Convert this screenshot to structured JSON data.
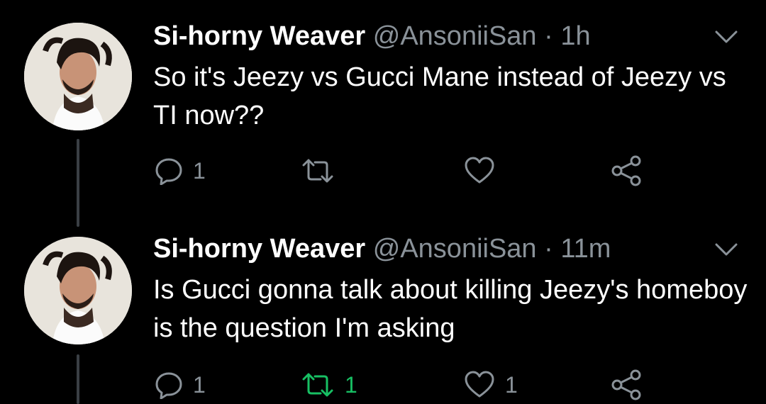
{
  "colors": {
    "background": "#000000",
    "secondary_text": "#8a9299",
    "retweeted": "#17bf63",
    "thread_line": "#3a3f44"
  },
  "tweets": [
    {
      "name": "Si-horny Weaver",
      "handle": "@AnsoniiSan",
      "separator": "·",
      "time": "1h",
      "text": "So it's Jeezy vs Gucci Mane instead of Jeezy vs TI now??",
      "reply_count": "1",
      "retweet_count": "",
      "like_count": "",
      "retweeted": false,
      "icons": [
        "avatar",
        "chevron-down-icon",
        "reply-icon",
        "retweet-icon",
        "like-icon",
        "share-icon"
      ]
    },
    {
      "name": "Si-horny Weaver",
      "handle": "@AnsoniiSan",
      "separator": "·",
      "time": "11m",
      "text": "Is Gucci gonna talk about killing Jeezy's homeboy is the question I'm asking",
      "reply_count": "1",
      "retweet_count": "1",
      "like_count": "1",
      "retweeted": true,
      "icons": [
        "avatar",
        "chevron-down-icon",
        "reply-icon",
        "retweet-icon",
        "like-icon",
        "share-icon"
      ]
    }
  ]
}
